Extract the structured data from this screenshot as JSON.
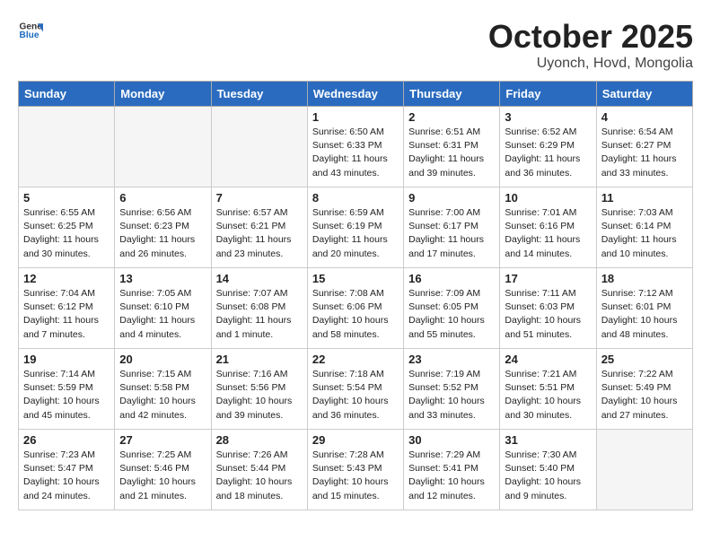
{
  "header": {
    "logo_general": "General",
    "logo_blue": "Blue",
    "month": "October 2025",
    "location": "Uyonch, Hovd, Mongolia"
  },
  "weekdays": [
    "Sunday",
    "Monday",
    "Tuesday",
    "Wednesday",
    "Thursday",
    "Friday",
    "Saturday"
  ],
  "weeks": [
    [
      {
        "day": "",
        "info": ""
      },
      {
        "day": "",
        "info": ""
      },
      {
        "day": "",
        "info": ""
      },
      {
        "day": "1",
        "info": "Sunrise: 6:50 AM\nSunset: 6:33 PM\nDaylight: 11 hours\nand 43 minutes."
      },
      {
        "day": "2",
        "info": "Sunrise: 6:51 AM\nSunset: 6:31 PM\nDaylight: 11 hours\nand 39 minutes."
      },
      {
        "day": "3",
        "info": "Sunrise: 6:52 AM\nSunset: 6:29 PM\nDaylight: 11 hours\nand 36 minutes."
      },
      {
        "day": "4",
        "info": "Sunrise: 6:54 AM\nSunset: 6:27 PM\nDaylight: 11 hours\nand 33 minutes."
      }
    ],
    [
      {
        "day": "5",
        "info": "Sunrise: 6:55 AM\nSunset: 6:25 PM\nDaylight: 11 hours\nand 30 minutes."
      },
      {
        "day": "6",
        "info": "Sunrise: 6:56 AM\nSunset: 6:23 PM\nDaylight: 11 hours\nand 26 minutes."
      },
      {
        "day": "7",
        "info": "Sunrise: 6:57 AM\nSunset: 6:21 PM\nDaylight: 11 hours\nand 23 minutes."
      },
      {
        "day": "8",
        "info": "Sunrise: 6:59 AM\nSunset: 6:19 PM\nDaylight: 11 hours\nand 20 minutes."
      },
      {
        "day": "9",
        "info": "Sunrise: 7:00 AM\nSunset: 6:17 PM\nDaylight: 11 hours\nand 17 minutes."
      },
      {
        "day": "10",
        "info": "Sunrise: 7:01 AM\nSunset: 6:16 PM\nDaylight: 11 hours\nand 14 minutes."
      },
      {
        "day": "11",
        "info": "Sunrise: 7:03 AM\nSunset: 6:14 PM\nDaylight: 11 hours\nand 10 minutes."
      }
    ],
    [
      {
        "day": "12",
        "info": "Sunrise: 7:04 AM\nSunset: 6:12 PM\nDaylight: 11 hours\nand 7 minutes."
      },
      {
        "day": "13",
        "info": "Sunrise: 7:05 AM\nSunset: 6:10 PM\nDaylight: 11 hours\nand 4 minutes."
      },
      {
        "day": "14",
        "info": "Sunrise: 7:07 AM\nSunset: 6:08 PM\nDaylight: 11 hours\nand 1 minute."
      },
      {
        "day": "15",
        "info": "Sunrise: 7:08 AM\nSunset: 6:06 PM\nDaylight: 10 hours\nand 58 minutes."
      },
      {
        "day": "16",
        "info": "Sunrise: 7:09 AM\nSunset: 6:05 PM\nDaylight: 10 hours\nand 55 minutes."
      },
      {
        "day": "17",
        "info": "Sunrise: 7:11 AM\nSunset: 6:03 PM\nDaylight: 10 hours\nand 51 minutes."
      },
      {
        "day": "18",
        "info": "Sunrise: 7:12 AM\nSunset: 6:01 PM\nDaylight: 10 hours\nand 48 minutes."
      }
    ],
    [
      {
        "day": "19",
        "info": "Sunrise: 7:14 AM\nSunset: 5:59 PM\nDaylight: 10 hours\nand 45 minutes."
      },
      {
        "day": "20",
        "info": "Sunrise: 7:15 AM\nSunset: 5:58 PM\nDaylight: 10 hours\nand 42 minutes."
      },
      {
        "day": "21",
        "info": "Sunrise: 7:16 AM\nSunset: 5:56 PM\nDaylight: 10 hours\nand 39 minutes."
      },
      {
        "day": "22",
        "info": "Sunrise: 7:18 AM\nSunset: 5:54 PM\nDaylight: 10 hours\nand 36 minutes."
      },
      {
        "day": "23",
        "info": "Sunrise: 7:19 AM\nSunset: 5:52 PM\nDaylight: 10 hours\nand 33 minutes."
      },
      {
        "day": "24",
        "info": "Sunrise: 7:21 AM\nSunset: 5:51 PM\nDaylight: 10 hours\nand 30 minutes."
      },
      {
        "day": "25",
        "info": "Sunrise: 7:22 AM\nSunset: 5:49 PM\nDaylight: 10 hours\nand 27 minutes."
      }
    ],
    [
      {
        "day": "26",
        "info": "Sunrise: 7:23 AM\nSunset: 5:47 PM\nDaylight: 10 hours\nand 24 minutes."
      },
      {
        "day": "27",
        "info": "Sunrise: 7:25 AM\nSunset: 5:46 PM\nDaylight: 10 hours\nand 21 minutes."
      },
      {
        "day": "28",
        "info": "Sunrise: 7:26 AM\nSunset: 5:44 PM\nDaylight: 10 hours\nand 18 minutes."
      },
      {
        "day": "29",
        "info": "Sunrise: 7:28 AM\nSunset: 5:43 PM\nDaylight: 10 hours\nand 15 minutes."
      },
      {
        "day": "30",
        "info": "Sunrise: 7:29 AM\nSunset: 5:41 PM\nDaylight: 10 hours\nand 12 minutes."
      },
      {
        "day": "31",
        "info": "Sunrise: 7:30 AM\nSunset: 5:40 PM\nDaylight: 10 hours\nand 9 minutes."
      },
      {
        "day": "",
        "info": ""
      }
    ]
  ]
}
